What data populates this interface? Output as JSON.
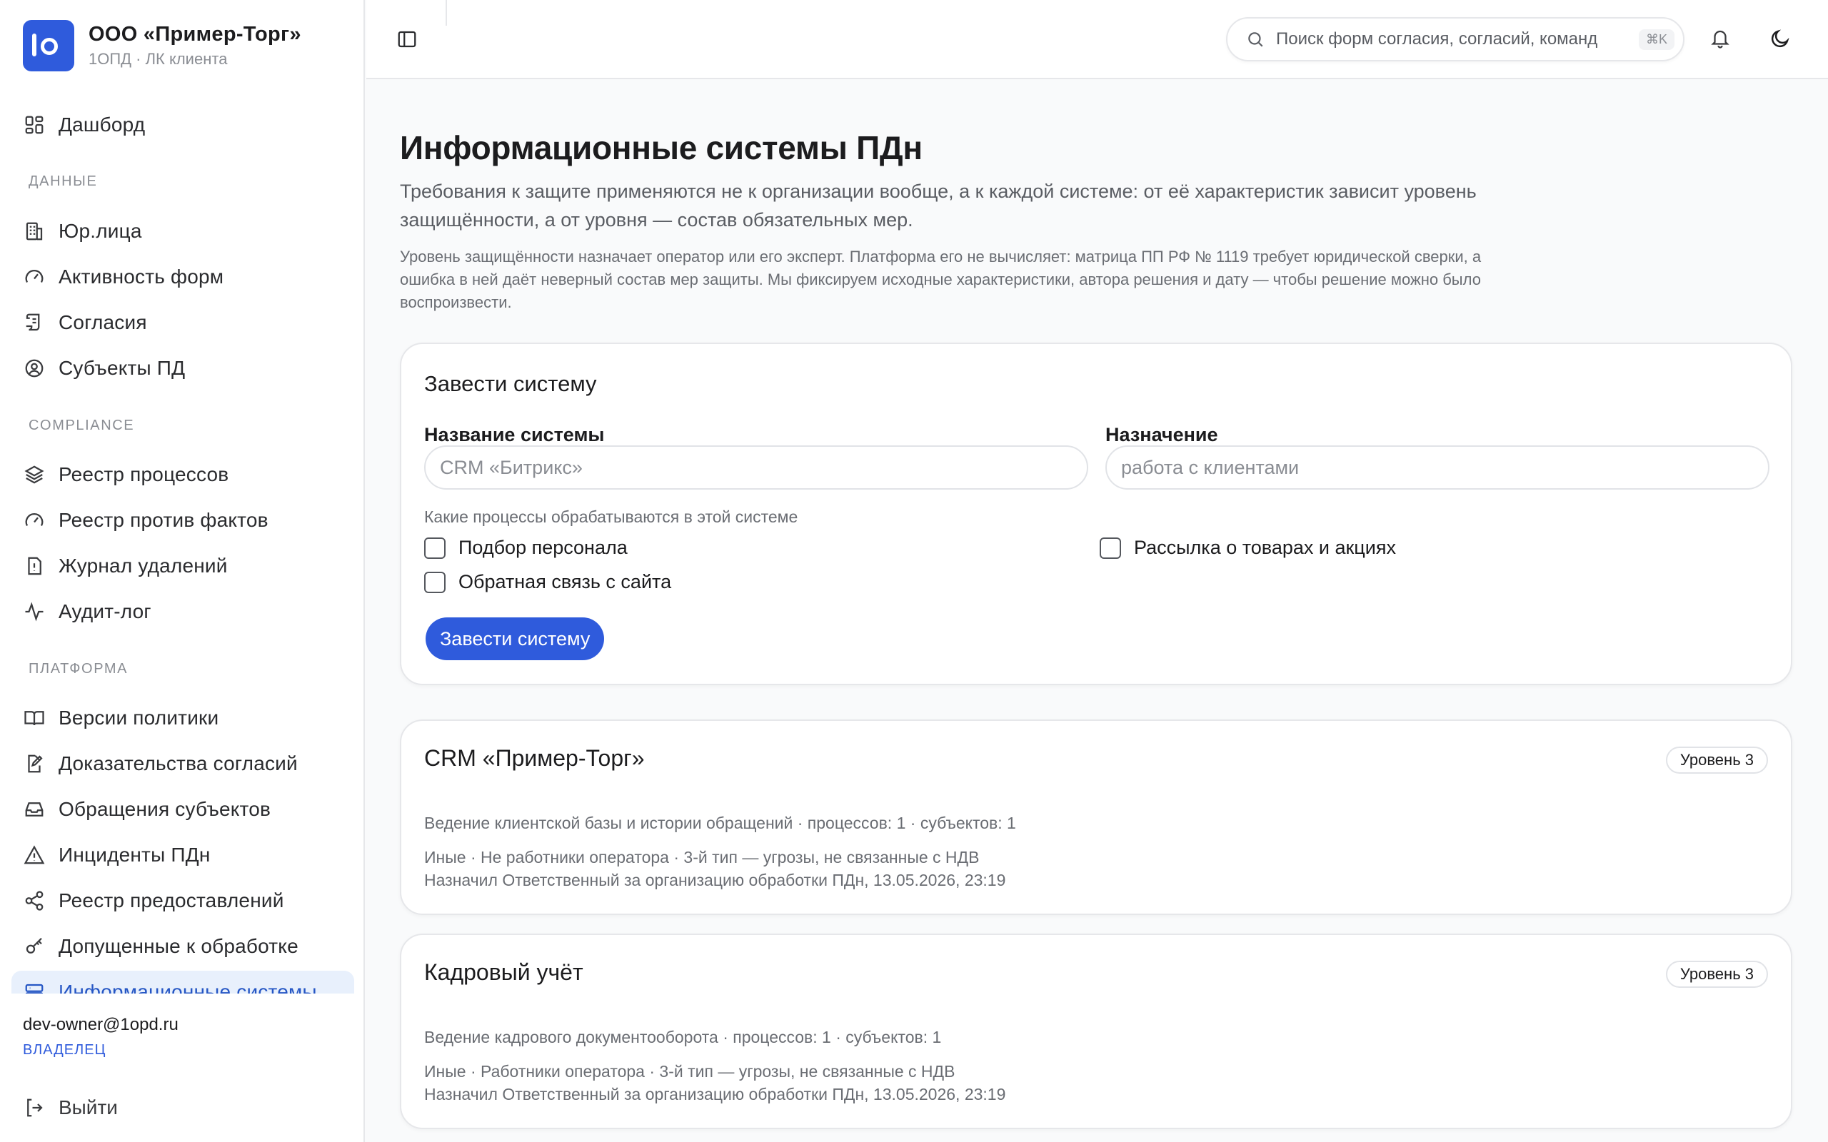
{
  "brand": {
    "name": "ООО «Пример-Торг»",
    "subtitle": "1ОПД · ЛК клиента"
  },
  "nav": {
    "dashboard": "Дашборд",
    "section_data": "ДАННЫЕ",
    "data_items": [
      "Юр.лица",
      "Активность форм",
      "Согласия",
      "Субъекты ПД"
    ],
    "section_compliance": "COMPLIANCE",
    "compliance_items": [
      "Реестр процессов",
      "Реестр против фактов",
      "Журнал удалений",
      "Аудит-лог"
    ],
    "section_platform": "ПЛАТФОРМА",
    "platform_items": [
      "Версии политики",
      "Доказательства согласий",
      "Обращения субъектов",
      "Инциденты ПДн",
      "Реестр предоставлений",
      "Допущенные к обработке",
      "Информационные системы"
    ]
  },
  "user": {
    "email": "dev-owner@1opd.ru",
    "role": "ВЛАДЕЛЕЦ",
    "logout": "Выйти"
  },
  "topbar": {
    "search_placeholder": "Поиск форм согласия, согласий, команд",
    "shortcut": "⌘K"
  },
  "page": {
    "title": "Информационные системы ПДн",
    "lead": "Требования к защите применяются не к организации вообще, а к каждой системе: от её характеристик зависит уровень защищённости, а от уровня — состав обязательных мер.",
    "note": "Уровень защищённости назначает оператор или его эксперт. Платформа его не вычисляет: матрица ПП РФ № 1119 требует юридической сверки, а ошибка в ней даёт неверный состав мер защиты. Мы фиксируем исходные характеристики, автора решения и дату — чтобы решение можно было воспроизвести."
  },
  "form": {
    "title": "Завести систему",
    "name_label": "Название системы",
    "name_placeholder": "CRM «Битрикс»",
    "purpose_label": "Назначение",
    "purpose_placeholder": "работа с клиентами",
    "processes_label": "Какие процессы обрабатываются в этой системе",
    "processes": [
      "Подбор персонала",
      "Рассылка о товарах и акциях",
      "Обратная связь с сайта"
    ],
    "submit": "Завести систему"
  },
  "systems": [
    {
      "title": "CRM «Пример-Торг»",
      "level": "Уровень 3",
      "summary": "Ведение клиентской базы и истории обращений · процессов: 1 · субъектов: 1",
      "details": "Иные · Не работники оператора · 3-й тип — угрозы, не связанные с НДВ",
      "assigned": "Назначил Ответственный за организацию обработки ПДн, 13.05.2026, 23:19"
    },
    {
      "title": "Кадровый учёт",
      "level": "Уровень 3",
      "summary": "Ведение кадрового документооборота · процессов: 1 · субъектов: 1",
      "details": "Иные · Работники оператора · 3-й тип — угрозы, не связанные с НДВ",
      "assigned": "Назначил Ответственный за организацию обработки ПДн, 13.05.2026, 23:19"
    }
  ]
}
